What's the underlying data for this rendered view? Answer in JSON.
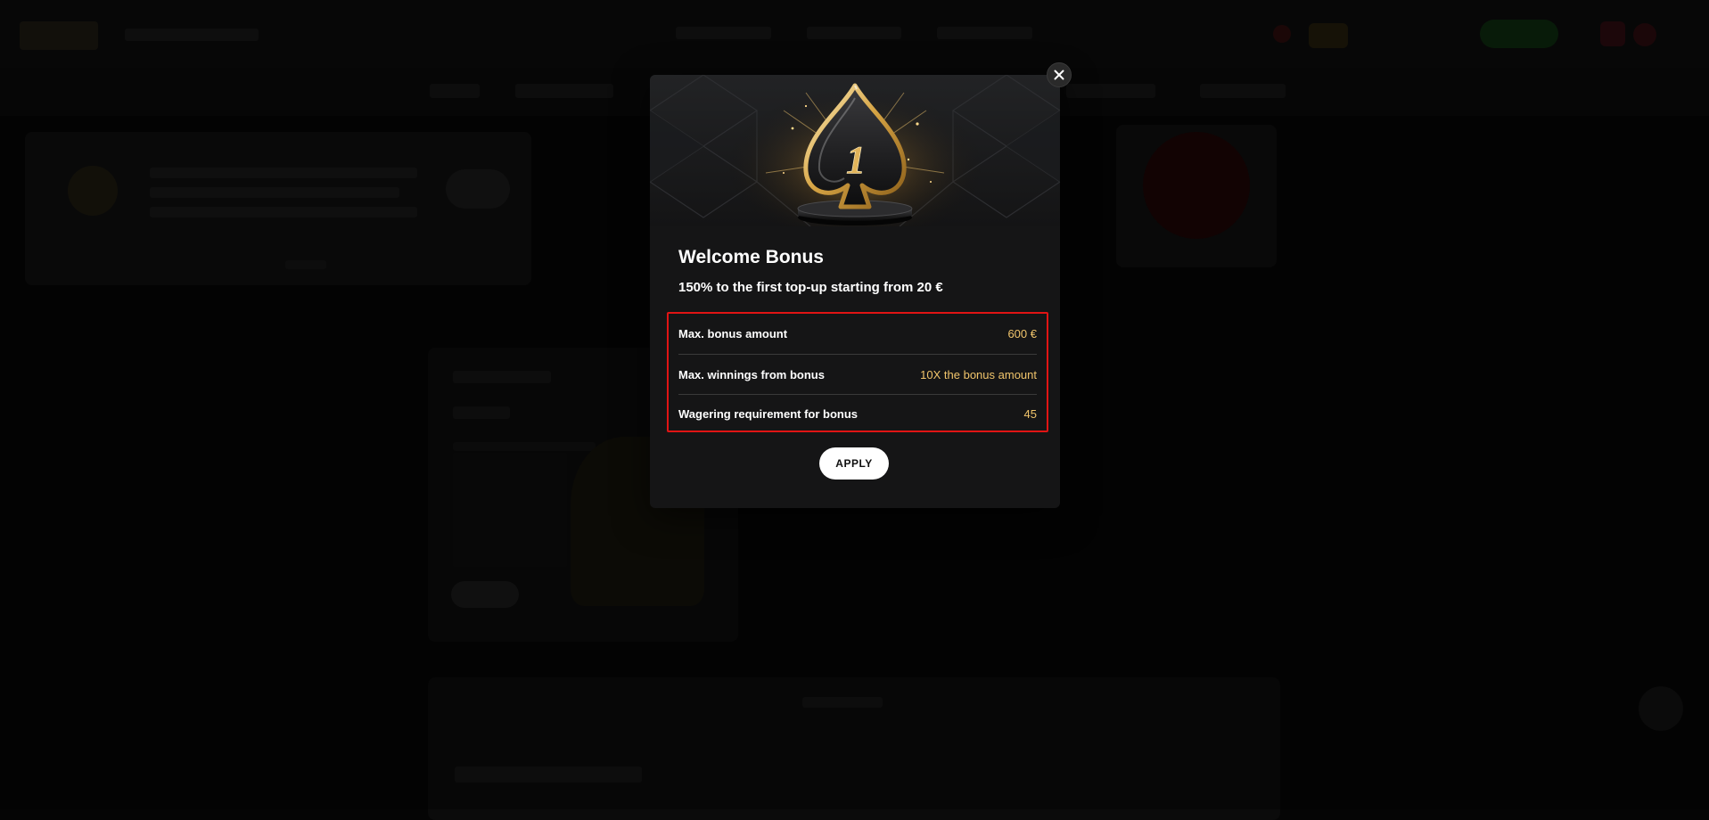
{
  "modal": {
    "title": "Welcome Bonus",
    "subtitle": "150% to the first top-up starting from 20 €",
    "hero_badge_number": "1",
    "hero_icon": "spade-trophy-icon",
    "details": [
      {
        "label": "Max. bonus amount",
        "value": "600 €"
      },
      {
        "label": "Max. winnings from bonus",
        "value": "10X the bonus amount"
      },
      {
        "label": "Wagering requirement for bonus",
        "value": "45"
      }
    ],
    "apply_label": "APPLY",
    "close_icon": "close-icon"
  },
  "colors": {
    "modal_background": "#151516",
    "value_accent": "#f0c46b",
    "highlight_border": "#e01414",
    "apply_button": "#ffffff",
    "gold": "#d8a64a"
  }
}
